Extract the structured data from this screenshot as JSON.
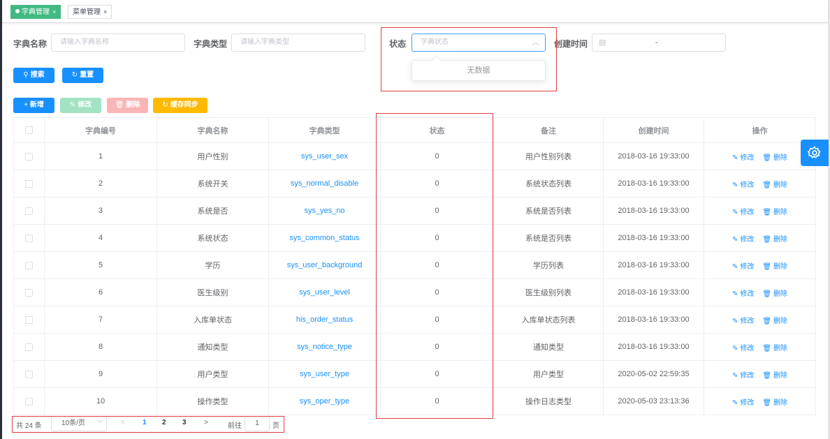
{
  "tabs": [
    {
      "label": "字典管理",
      "close": "×"
    },
    {
      "label": "菜单管理",
      "close": "×"
    }
  ],
  "form": {
    "dict_name_label": "字典名称",
    "dict_name_placeholder": "请输入字典名称",
    "dict_type_label": "字典类型",
    "dict_type_placeholder": "请输入字典类型",
    "status_label": "状态",
    "status_placeholder": "字典状态",
    "status_empty": "无数据",
    "created_label": "创建时间",
    "date_separator": "-",
    "search_button": "搜索",
    "reset_button": "重置"
  },
  "toolbar": {
    "add": "新增",
    "edit": "修改",
    "delete": "删除",
    "sync": "缓存同步"
  },
  "table": {
    "headers": [
      "字典编号",
      "字典名称",
      "字典类型",
      "状态",
      "备注",
      "创建时间",
      "操作"
    ],
    "edit_label": "修改",
    "delete_label": "删除",
    "rows": [
      {
        "id": "1",
        "name": "用户性别",
        "type": "sys_user_sex",
        "status": "0",
        "remark": "用户性别列表",
        "created": "2018-03-16 19:33:00"
      },
      {
        "id": "2",
        "name": "系统开关",
        "type": "sys_normal_disable",
        "status": "0",
        "remark": "系统状态列表",
        "created": "2018-03-16 19:33:00"
      },
      {
        "id": "3",
        "name": "系统是否",
        "type": "sys_yes_no",
        "status": "0",
        "remark": "系统是否列表",
        "created": "2018-03-16 19:33:00"
      },
      {
        "id": "4",
        "name": "系统状态",
        "type": "sys_common_status",
        "status": "0",
        "remark": "系统是否列表",
        "created": "2018-03-16 19:33:00"
      },
      {
        "id": "5",
        "name": "学历",
        "type": "sys_user_background",
        "status": "0",
        "remark": "学历列表",
        "created": "2018-03-16 19:33:00"
      },
      {
        "id": "6",
        "name": "医生级别",
        "type": "sys_user_level",
        "status": "0",
        "remark": "医生级别列表",
        "created": "2018-03-16 19:33:00"
      },
      {
        "id": "7",
        "name": "入库单状态",
        "type": "his_order_status",
        "status": "0",
        "remark": "入库单状态列表",
        "created": "2018-03-16 19:33:00"
      },
      {
        "id": "8",
        "name": "通知类型",
        "type": "sys_notice_type",
        "status": "0",
        "remark": "通知类型",
        "created": "2018-03-16 19:33:00"
      },
      {
        "id": "9",
        "name": "用户类型",
        "type": "sys_user_type",
        "status": "0",
        "remark": "用户类型",
        "created": "2020-05-02 22:59:35"
      },
      {
        "id": "10",
        "name": "操作类型",
        "type": "sys_oper_type",
        "status": "0",
        "remark": "操作日志类型",
        "created": "2020-05-03 23:13:36"
      }
    ]
  },
  "pagination": {
    "total": "共 24 条",
    "page_size": "10条/页",
    "pages": [
      "1",
      "2",
      "3"
    ],
    "goto_label": "前往",
    "goto_value": "1",
    "page_unit": "页"
  }
}
